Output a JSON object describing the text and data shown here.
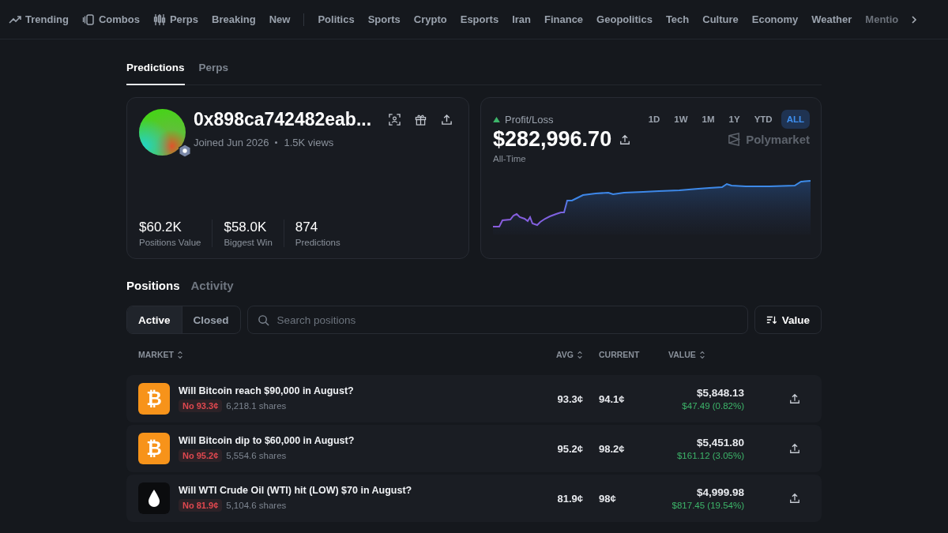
{
  "nav": {
    "items": [
      {
        "label": "Trending",
        "kind": "trending"
      },
      {
        "label": "Combos",
        "kind": "combos"
      },
      {
        "label": "Perps",
        "kind": "candles"
      },
      {
        "label": "Breaking"
      },
      {
        "label": "New"
      },
      {
        "kind": "divider"
      },
      {
        "label": "Politics"
      },
      {
        "label": "Sports"
      },
      {
        "label": "Crypto"
      },
      {
        "label": "Esports"
      },
      {
        "label": "Iran"
      },
      {
        "label": "Finance"
      },
      {
        "label": "Geopolitics"
      },
      {
        "label": "Tech"
      },
      {
        "label": "Culture"
      },
      {
        "label": "Economy"
      },
      {
        "label": "Weather"
      },
      {
        "label": "Mentio",
        "faded": true
      }
    ]
  },
  "tabs": [
    {
      "label": "Predictions",
      "selected": true
    },
    {
      "label": "Perps",
      "selected": false
    }
  ],
  "profile": {
    "name": "0x898ca742482eab...",
    "joined": "Joined Jun 2026",
    "views": "1.5K views",
    "stats": [
      {
        "value": "$60.2K",
        "label": "Positions Value"
      },
      {
        "value": "$58.0K",
        "label": "Biggest Win"
      },
      {
        "value": "874",
        "label": "Predictions"
      }
    ]
  },
  "pnl": {
    "label": "Profit/Loss",
    "amount": "$282,996.70",
    "period": "All-Time",
    "brand": "Polymarket",
    "ranges": [
      {
        "label": "1D",
        "selected": false
      },
      {
        "label": "1W",
        "selected": false
      },
      {
        "label": "1M",
        "selected": false
      },
      {
        "label": "1Y",
        "selected": false
      },
      {
        "label": "YTD",
        "selected": false
      },
      {
        "label": "ALL",
        "selected": true
      }
    ]
  },
  "section_tabs": [
    {
      "label": "Positions",
      "selected": true
    },
    {
      "label": "Activity",
      "selected": false
    }
  ],
  "filters": [
    {
      "label": "Active",
      "selected": true
    },
    {
      "label": "Closed",
      "selected": false
    }
  ],
  "search": {
    "placeholder": "Search positions"
  },
  "sort_button": "Value",
  "table": {
    "columns": [
      {
        "label": "MARKET",
        "sortable": true
      },
      {
        "label": "AVG",
        "sortable": true
      },
      {
        "label": "CURRENT",
        "sortable": false
      },
      {
        "label": "VALUE",
        "sortable": true
      }
    ],
    "rows": [
      {
        "kind": "bitcoin",
        "glyph": "₿",
        "title": "Will Bitcoin reach $90,000 in August?",
        "outcome": "No 93.3¢",
        "shares": "6,218.1 shares",
        "avg": "93.3¢",
        "current": "94.1¢",
        "value": "$5,848.13",
        "pnl": "$47.49 (0.82%)"
      },
      {
        "kind": "bitcoin",
        "glyph": "₿",
        "title": "Will Bitcoin dip to $60,000 in August?",
        "outcome": "No 95.2¢",
        "shares": "5,554.6 shares",
        "avg": "95.2¢",
        "current": "98.2¢",
        "value": "$5,451.80",
        "pnl": "$161.12 (3.05%)"
      },
      {
        "kind": "oil",
        "title": "Will WTI Crude Oil (WTI) hit (LOW) $70 in August?",
        "outcome": "No 81.9¢",
        "shares": "5,104.6 shares",
        "avg": "81.9¢",
        "current": "98¢",
        "value": "$4,999.98",
        "pnl": "$817.45 (19.54%)"
      }
    ]
  }
}
